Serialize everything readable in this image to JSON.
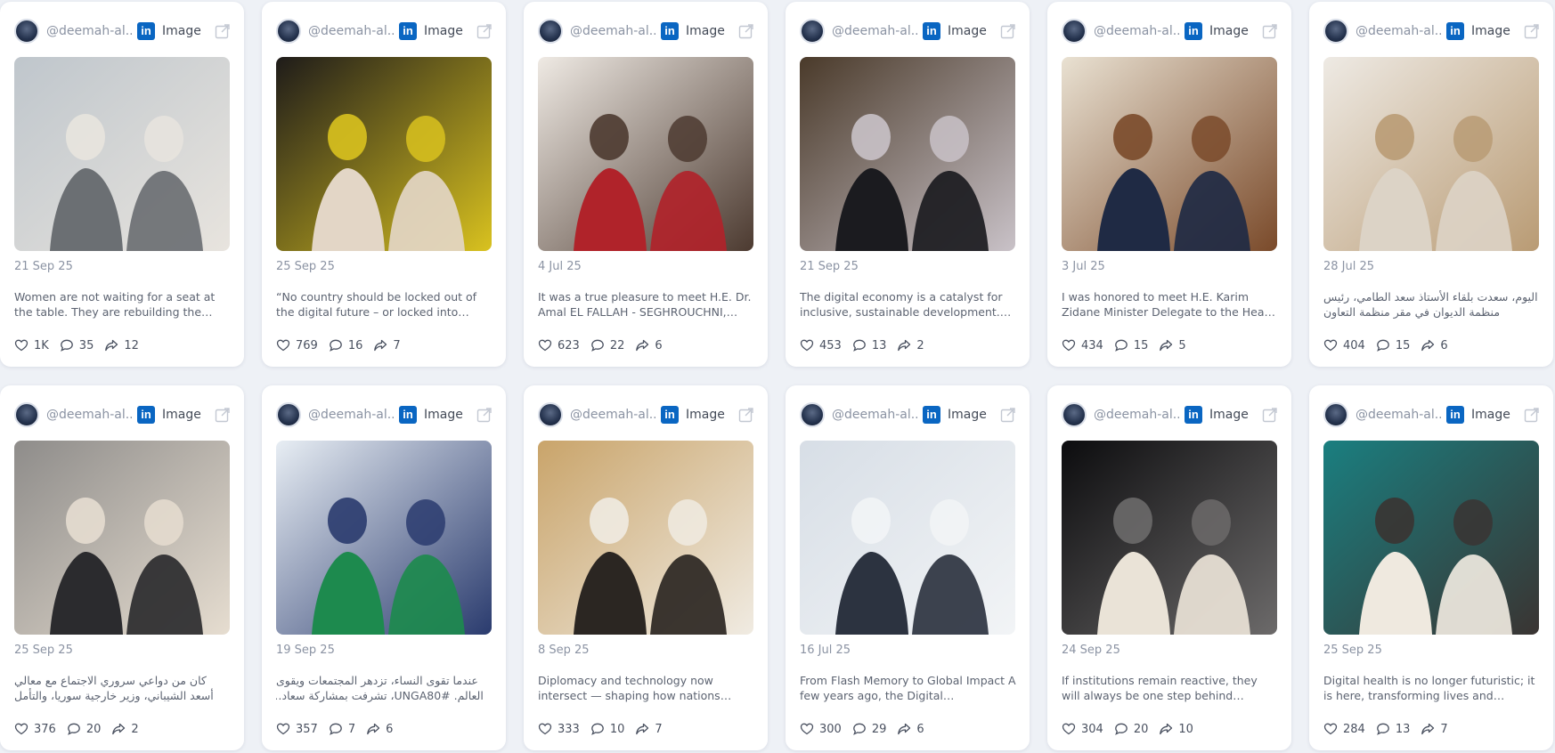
{
  "colors": {
    "background": "#eef1f6",
    "card": "#ffffff",
    "linkedin": "#0a66c2",
    "muted_text": "#8b93a3",
    "body_text": "#5c6371"
  },
  "posts": [
    {
      "handle": "@deemah-al...",
      "platform_icon": "linkedin-icon",
      "type": "Image",
      "date": "21 Sep 25",
      "caption": "Women are not waiting for a seat at the table. They are rebuilding the table with...",
      "likes": "1K",
      "comments": "35",
      "shares": "12",
      "photo": [
        "#bfc6cc",
        "#6b6f73",
        "#e8e4de"
      ]
    },
    {
      "handle": "@deemah-al...",
      "platform_icon": "linkedin-icon",
      "type": "Image",
      "date": "25 Sep 25",
      "caption": "“No country should be locked out of the digital future – or locked into systems it...",
      "likes": "769",
      "comments": "16",
      "shares": "7",
      "photo": [
        "#1e1b1a",
        "#e3d6c6",
        "#d9c21f"
      ]
    },
    {
      "handle": "@deemah-al...",
      "platform_icon": "linkedin-icon",
      "type": "Image",
      "date": "4 Jul 25",
      "caption": "It was a true pleasure to meet H.E. Dr. Amal EL FALLAH - SEGHROUCHNI, Minister...",
      "likes": "623",
      "comments": "22",
      "shares": "6",
      "photo": [
        "#efeae4",
        "#b0232a",
        "#4c3a30"
      ]
    },
    {
      "handle": "@deemah-al...",
      "platform_icon": "linkedin-icon",
      "type": "Image",
      "date": "21 Sep 25",
      "caption": "The digital economy is a catalyst for inclusive, sustainable development.   At...",
      "likes": "453",
      "comments": "13",
      "shares": "2",
      "photo": [
        "#4a3a2a",
        "#1b1b1f",
        "#c9c2c8"
      ]
    },
    {
      "handle": "@deemah-al...",
      "platform_icon": "linkedin-icon",
      "type": "Image",
      "date": "3 Jul 25",
      "caption": "I was honored to meet H.E. Karim Zidane Minister Delegate to the Head of...",
      "likes": "434",
      "comments": "15",
      "shares": "5",
      "photo": [
        "#e9e1d2",
        "#1f2a44",
        "#7a4a2a"
      ]
    },
    {
      "handle": "@deemah-al...",
      "platform_icon": "linkedin-icon",
      "type": "Image",
      "date": "28 Jul 25",
      "caption": "اليوم، سعدت بلقاء الأستاذ سعد الطامي، رئيس منظمة الديوان في مقر منظمة التعاون الرقمي...",
      "rtl": true,
      "likes": "404",
      "comments": "15",
      "shares": "6",
      "photo": [
        "#eeeae4",
        "#dcd3c6",
        "#b99b74"
      ]
    },
    {
      "handle": "@deemah-al...",
      "platform_icon": "linkedin-icon",
      "type": "Image",
      "date": "25 Sep 25",
      "caption": "كان من دواعي سروري الاجتماع مع معالي أسعد الشيباني، وزير خارجية سوريا، والتأمل في كيف...",
      "rtl": true,
      "likes": "376",
      "comments": "20",
      "shares": "2",
      "photo": [
        "#8e8c8a",
        "#2b2b2e",
        "#e6ddd0"
      ]
    },
    {
      "handle": "@deemah-al...",
      "platform_icon": "linkedin-icon",
      "type": "Image",
      "date": "19 Sep 25",
      "caption": "عندما تقوى النساء، تزدهر المجتمعات ويقوى العالم. #UNGA80، تشرفت بمشاركة سعادة الدكتورة في...",
      "rtl": true,
      "likes": "357",
      "comments": "7",
      "shares": "6",
      "photo": [
        "#e8eef4",
        "#1d8a4e",
        "#2a3b6e"
      ]
    },
    {
      "handle": "@deemah-al...",
      "platform_icon": "linkedin-icon",
      "type": "Image",
      "date": "8 Sep 25",
      "caption": "Diplomacy and technology now intersect — shaping how nations recover, rebuild,...",
      "likes": "333",
      "comments": "10",
      "shares": "7",
      "photo": [
        "#c9a46a",
        "#2b2622",
        "#f0ebe2"
      ]
    },
    {
      "handle": "@deemah-al...",
      "platform_icon": "linkedin-icon",
      "type": "Image",
      "date": "16 Jul 25",
      "caption": "From Flash Memory to Global Impact A few years ago, the Digital Cooperation...",
      "likes": "300",
      "comments": "29",
      "shares": "6",
      "photo": [
        "#d7dee6",
        "#2c3340",
        "#f2f4f6"
      ]
    },
    {
      "handle": "@deemah-al...",
      "platform_icon": "linkedin-icon",
      "type": "Image",
      "date": "24 Sep 25",
      "caption": "If institutions remain reactive, they will always be one step behind exponential...",
      "likes": "304",
      "comments": "20",
      "shares": "10",
      "photo": [
        "#0c0c0e",
        "#eae3d7",
        "#6c6a6a"
      ]
    },
    {
      "handle": "@deemah-al...",
      "platform_icon": "linkedin-icon",
      "type": "Image",
      "date": "25 Sep 25",
      "caption": "Digital health is no longer futuristic; it is here, transforming lives and reshaping...",
      "likes": "284",
      "comments": "13",
      "shares": "7",
      "photo": [
        "#1a7f80",
        "#efe9df",
        "#3a3432"
      ]
    }
  ]
}
